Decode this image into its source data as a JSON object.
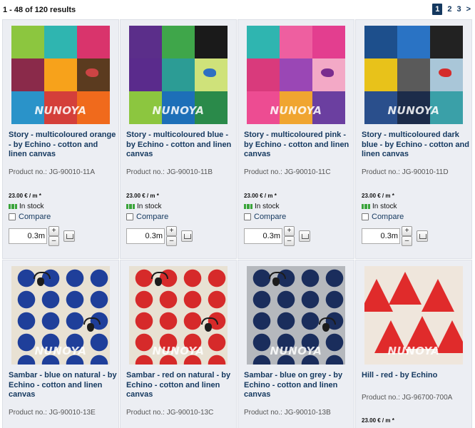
{
  "results_summary": "1 - 48 of 120 results",
  "pagination": {
    "pages": [
      "1",
      "2",
      "3"
    ],
    "next": ">",
    "current": "1"
  },
  "watermark": "NUNOYA",
  "products": [
    {
      "title": "Story - multicoloured orange - by Echino - cotton and linen canvas",
      "product_no": "Product no.: JG-90010-11A",
      "price": "23.00 € / m *",
      "stock": "In stock",
      "compare": "Compare",
      "qty": "0.3",
      "unit": "m",
      "thumb_style": "story-orange"
    },
    {
      "title": "Story - multicoloured blue - by Echino - cotton and linen canvas",
      "product_no": "Product no.: JG-90010-11B",
      "price": "23.00 € / m *",
      "stock": "In stock",
      "compare": "Compare",
      "qty": "0.3",
      "unit": "m",
      "thumb_style": "story-blue"
    },
    {
      "title": "Story - multicoloured pink - by Echino - cotton and linen canvas",
      "product_no": "Product no.: JG-90010-11C",
      "price": "23.00 € / m *",
      "stock": "In stock",
      "compare": "Compare",
      "qty": "0.3",
      "unit": "m",
      "thumb_style": "story-pink"
    },
    {
      "title": "Story - multicoloured dark blue - by Echino - cotton and linen canvas",
      "product_no": "Product no.: JG-90010-11D",
      "price": "23.00 € / m *",
      "stock": "In stock",
      "compare": "Compare",
      "qty": "0.3",
      "unit": "m",
      "thumb_style": "story-darkblue"
    },
    {
      "title": "Sambar - blue on natural - by Echino - cotton and linen canvas",
      "product_no": "Product no.: JG-90010-13E",
      "thumb_style": "sambar-blue-natural"
    },
    {
      "title": "Sambar - red on natural - by Echino - cotton and linen canvas",
      "product_no": "Product no.: JG-90010-13C",
      "thumb_style": "sambar-red-natural"
    },
    {
      "title": "Sambar - blue on grey - by Echino - cotton and linen canvas",
      "product_no": "Product no.: JG-90010-13B",
      "thumb_style": "sambar-blue-grey"
    },
    {
      "title": "Hill - red - by Echino",
      "product_no": "Product no.: JG-96700-700A",
      "price": "23.00 € / m *",
      "thumb_style": "hill-red"
    }
  ],
  "colors": {
    "link": "#14385f",
    "card_bg": "#eceef3",
    "stock_green": "#3aa43a",
    "pager_active": "#14385f"
  }
}
